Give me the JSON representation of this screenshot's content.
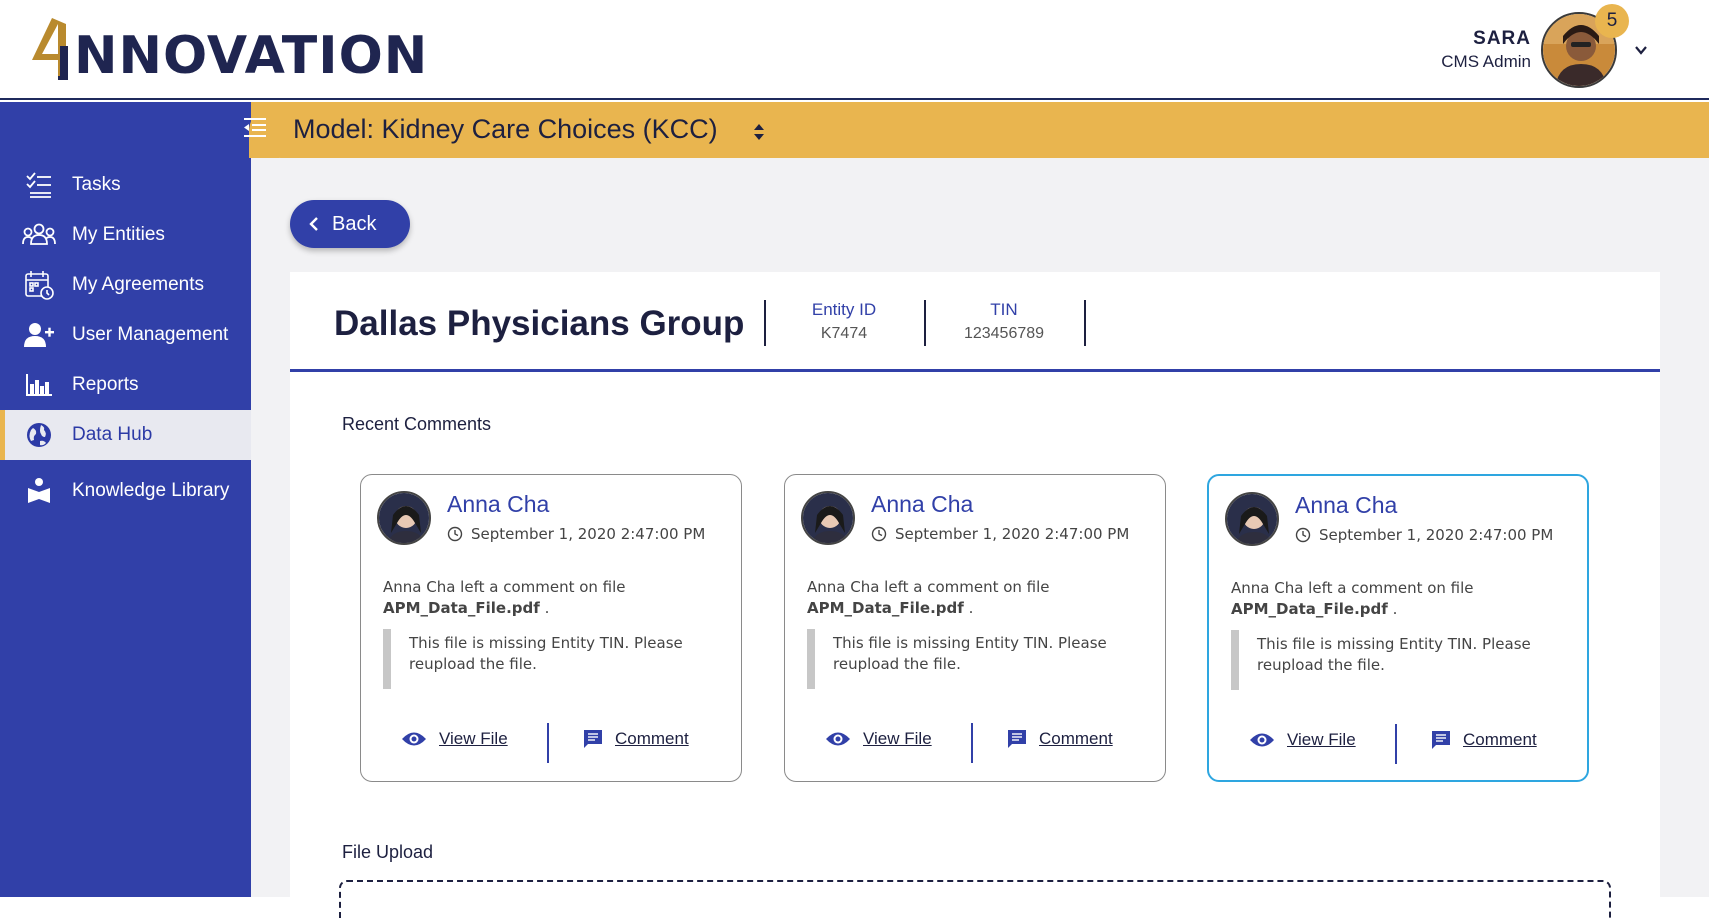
{
  "header": {
    "logo_number": "4",
    "logo_text": "NNOVATION",
    "user_name": "SARA",
    "user_role": "CMS Admin",
    "notification_count": "5"
  },
  "sidebar": {
    "items": [
      {
        "label": "Tasks",
        "icon": "tasks-icon"
      },
      {
        "label": "My Entities",
        "icon": "group-icon"
      },
      {
        "label": "My Agreements",
        "icon": "calendar-icon"
      },
      {
        "label": "User Management",
        "icon": "add-user-icon"
      },
      {
        "label": "Reports",
        "icon": "bar-chart-icon"
      },
      {
        "label": "Data Hub",
        "icon": "globe-icon",
        "active": true
      },
      {
        "label": "Knowledge Library",
        "icon": "reader-icon"
      }
    ]
  },
  "model_bar": {
    "label": "Model:  Kidney Care Choices (KCC)"
  },
  "back_label": "Back",
  "entity": {
    "name": "Dallas Physicians Group",
    "entity_id_label": "Entity ID",
    "entity_id": "K7474",
    "tin_label": "TIN",
    "tin": "123456789"
  },
  "recent_comments_title": "Recent Comments",
  "comments": [
    {
      "author": "Anna Cha",
      "date": "September 1,  2020 2:47:00 PM",
      "text": "Anna Cha left a comment on file",
      "file": "APM_Data_File.pdf",
      "quote": "This file is missing Entity TIN. Please reupload the file.",
      "view_label": "View File",
      "comment_label": "Comment"
    },
    {
      "author": "Anna Cha",
      "date": "September 1,  2020 2:47:00 PM",
      "text": "Anna Cha left a comment on file",
      "file": "APM_Data_File.pdf",
      "quote": "This file is missing Entity TIN. Please reupload the file.",
      "view_label": "View File",
      "comment_label": "Comment"
    },
    {
      "author": "Anna Cha",
      "date": "September 1,  2020 2:47:00 PM",
      "text": "Anna Cha left a comment on file",
      "file": "APM_Data_File.pdf",
      "quote": "This file is missing Entity TIN. Please reupload the file.",
      "view_label": "View File",
      "comment_label": "Comment"
    }
  ],
  "file_upload_title": "File Upload",
  "colors": {
    "primary": "#3140a8",
    "accent": "#e9b54f",
    "selected_border": "#2ea6e0"
  }
}
